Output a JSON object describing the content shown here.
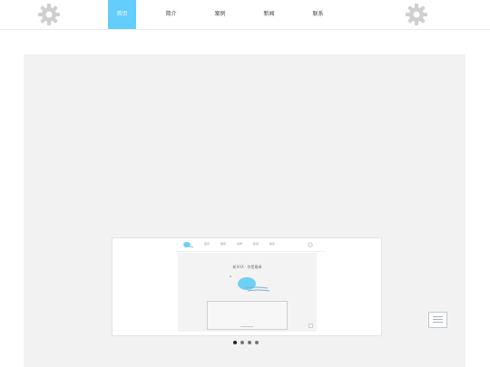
{
  "nav": {
    "items": [
      {
        "label": "首页",
        "active": true
      },
      {
        "label": "简介"
      },
      {
        "label": "案例"
      },
      {
        "label": "新闻"
      },
      {
        "label": "联系"
      }
    ]
  },
  "preview": {
    "mini_nav": [
      "首页",
      "服务",
      "案例",
      "新闻",
      "联系"
    ],
    "title": "新XXX · 你是最棒"
  },
  "carousel": {
    "slides": 4,
    "active": 0
  },
  "colors": {
    "accent": "#63cdfb",
    "panel": "#f2f2f2",
    "gear": "#cfcfcf"
  },
  "icons": {
    "left": "gear-icon",
    "right": "gear-icon",
    "menu": "hamburger-icon"
  }
}
